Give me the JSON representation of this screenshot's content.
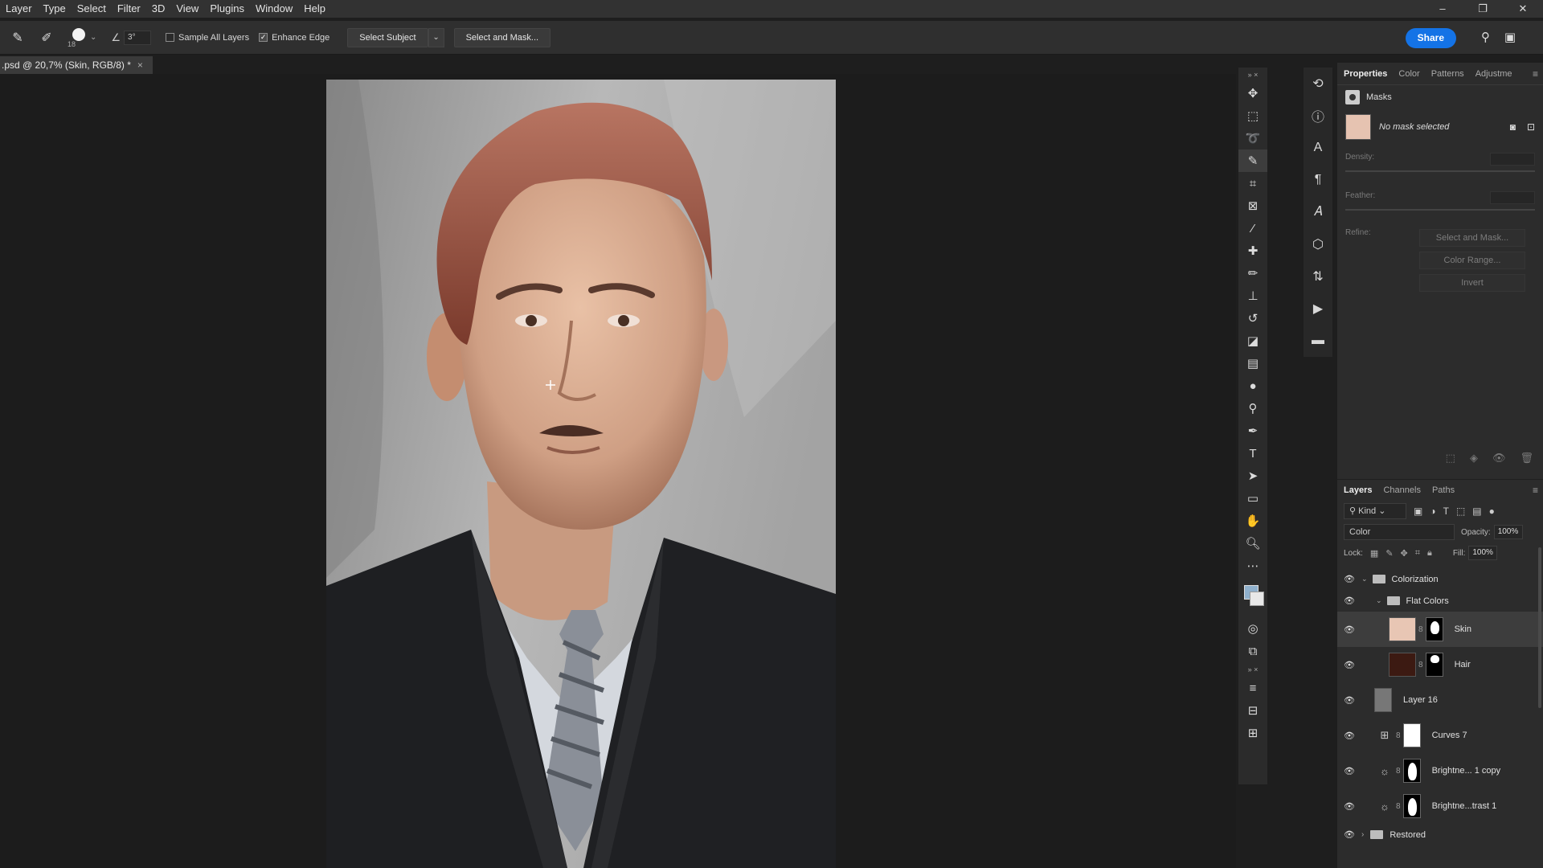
{
  "menu": [
    "Layer",
    "Type",
    "Select",
    "Filter",
    "3D",
    "View",
    "Plugins",
    "Window",
    "Help"
  ],
  "window_controls": [
    "–",
    "❐",
    "✕"
  ],
  "options": {
    "brush_size": "18",
    "angle": "3°",
    "sample_all_layers": "Sample All Layers",
    "enhance_edge": "Enhance Edge",
    "select_subject": "Select Subject",
    "select_and_mask": "Select and Mask...",
    "share": "Share"
  },
  "document": {
    "tab_title": ".psd @ 20,7% (Skin, RGB/8) *",
    "close": "×"
  },
  "properties_panel": {
    "tabs": [
      "Properties",
      "Color",
      "Patterns",
      "Adjustme"
    ],
    "section": "Masks",
    "no_mask": "No mask selected",
    "density_label": "Density:",
    "feather_label": "Feather:",
    "refine_label": "Refine:",
    "select_and_mask": "Select and Mask...",
    "color_range": "Color Range...",
    "invert": "Invert",
    "swatch_color": "#e6c3b1"
  },
  "layers_panel": {
    "tabs": [
      "Layers",
      "Channels",
      "Paths"
    ],
    "kind": "Kind",
    "blend_mode": "Color",
    "opacity_label": "Opacity:",
    "opacity": "100%",
    "lock_label": "Lock:",
    "fill_label": "Fill:",
    "fill": "100%",
    "layers": [
      {
        "name": "Colorization",
        "type": "group"
      },
      {
        "name": "Flat Colors",
        "type": "group"
      },
      {
        "name": "Skin",
        "type": "fill",
        "color": "#e8c6b4",
        "selected": true
      },
      {
        "name": "Hair",
        "type": "fill",
        "color": "#3c1a12"
      },
      {
        "name": "Layer 16",
        "type": "pixel"
      },
      {
        "name": "Curves 7",
        "type": "adjustment"
      },
      {
        "name": "Brightne... 1 copy",
        "type": "adjustment"
      },
      {
        "name": "Brightne...trast 1",
        "type": "adjustment"
      },
      {
        "name": "Restored",
        "type": "group"
      }
    ]
  },
  "colors": {
    "accent": "#1473e6",
    "foreground_swatch": "#8fb0cc",
    "background_swatch": "#e8e8e8"
  }
}
